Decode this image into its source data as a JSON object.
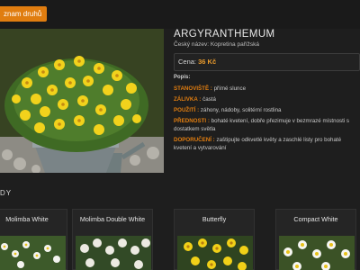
{
  "nav": {
    "back_label": "znam druhů"
  },
  "product": {
    "title": "ARGYRANTHEMUM",
    "common_name": "Český název: Kopretina pařížská",
    "price_label": "Cena:",
    "price_value": "36 Kč",
    "description_heading": "Popis:",
    "attributes": [
      {
        "key": "STANOVIŠTĚ :",
        "value": "přímé slunce"
      },
      {
        "key": "ZÁLIVKA :",
        "value": "častá"
      },
      {
        "key": "POUŽITÍ :",
        "value": "záhony, nádoby, solitérní rostlina"
      },
      {
        "key": "PŘEDNOSTI :",
        "value": "bohaté kvetení, dobře přezimuje v bezmrazé místnosti s dostatkem světla"
      },
      {
        "key": "DOPORUČENÍ :",
        "value": "zaštipujte odkvetlé květy a zaschlé listy pro bohaté kvetení a vytvarování"
      }
    ]
  },
  "related": {
    "heading": "DY",
    "cards": [
      {
        "title": "Molimba White"
      },
      {
        "title": "Molimba Double White"
      },
      {
        "title": "Butterfly"
      },
      {
        "title": "Compact White"
      }
    ]
  },
  "colors": {
    "accent": "#e07d10",
    "background": "#1e1e1e",
    "card": "#252525"
  },
  "icons": {
    "hero": "yellow-daisy-pot-photo"
  }
}
